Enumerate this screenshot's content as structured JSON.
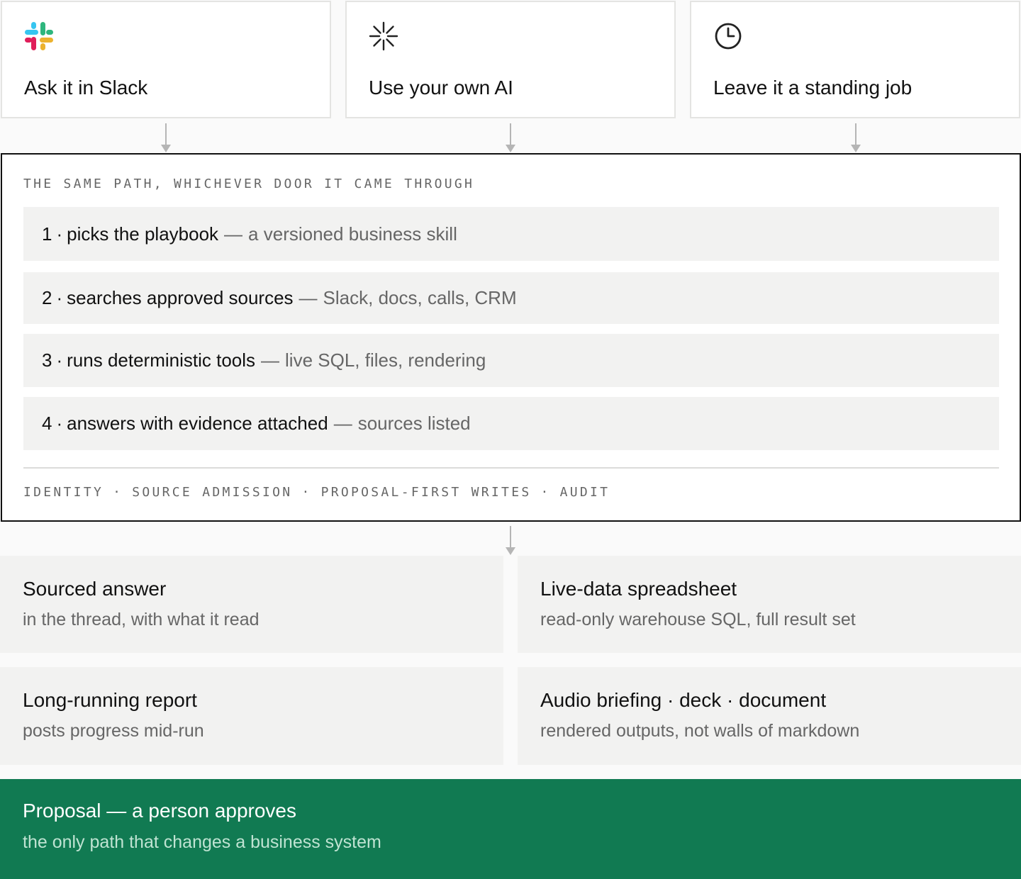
{
  "entries": [
    {
      "label": "Ask it in Slack",
      "icon": "slack-icon"
    },
    {
      "label": "Use your own AI",
      "icon": "asterisk-icon"
    },
    {
      "label": "Leave it a standing job",
      "icon": "clock-icon"
    }
  ],
  "path": {
    "heading": "THE SAME PATH, WHICHEVER DOOR IT CAME THROUGH",
    "steps": [
      {
        "num": "1",
        "title": "picks the playbook",
        "desc": "a versioned business skill"
      },
      {
        "num": "2",
        "title": "searches approved sources",
        "desc": "Slack, docs, calls, CRM"
      },
      {
        "num": "3",
        "title": "runs deterministic tools",
        "desc": "live SQL, files, rendering"
      },
      {
        "num": "4",
        "title": "answers with evidence attached",
        "desc": "sources listed"
      }
    ],
    "separator_dot": "·",
    "separator_dash": "—",
    "guards": [
      "IDENTITY",
      "SOURCE ADMISSION",
      "PROPOSAL-FIRST WRITES",
      "AUDIT"
    ],
    "guard_separator": "·"
  },
  "outputs": [
    {
      "title": "Sourced answer",
      "desc": "in the thread, with what it read"
    },
    {
      "title": "Live-data spreadsheet",
      "desc": "read-only warehouse SQL, full result set"
    },
    {
      "title": "Long-running report",
      "desc": "posts progress mid-run"
    },
    {
      "title": "Audio briefing · deck · document",
      "desc": "rendered outputs, not walls of markdown"
    }
  ],
  "proposal": {
    "title": "Proposal — a person approves",
    "desc": "the only path that changes a business system"
  },
  "colors": {
    "proposal_bg": "#117a52",
    "step_bg": "#f2f2f1",
    "muted_text": "#666666",
    "slack_blue": "#36c5f0",
    "slack_green": "#2eb67d",
    "slack_yellow": "#ecb22e",
    "slack_red": "#e01e5a"
  }
}
